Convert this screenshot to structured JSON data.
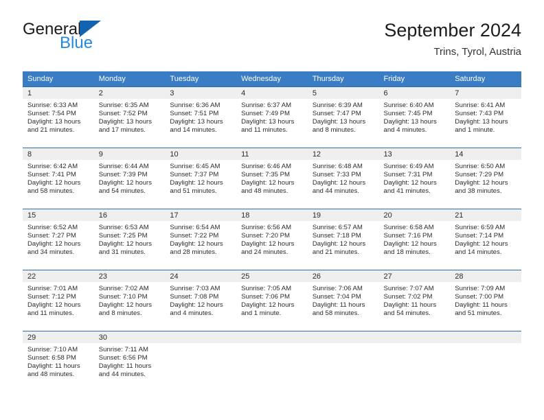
{
  "brand": {
    "name_part1": "General",
    "name_part2": "Blue",
    "logo_icon": "triangle-flag-icon",
    "accent_color": "#2389e0",
    "triangle_color": "#1263b0"
  },
  "header": {
    "title": "September 2024",
    "subtitle": "Trins, Tyrol, Austria"
  },
  "theme": {
    "header_row_bg": "#3b7dc4",
    "cell_border": "#2f6daf",
    "daynum_bg": "#efeff0",
    "text_color": "#2b2b2b"
  },
  "weekday_headers": [
    "Sunday",
    "Monday",
    "Tuesday",
    "Wednesday",
    "Thursday",
    "Friday",
    "Saturday"
  ],
  "weeks": [
    [
      {
        "day": "1",
        "sunrise": "Sunrise: 6:33 AM",
        "sunset": "Sunset: 7:54 PM",
        "daylight_line1": "Daylight: 13 hours",
        "daylight_line2": "and 21 minutes."
      },
      {
        "day": "2",
        "sunrise": "Sunrise: 6:35 AM",
        "sunset": "Sunset: 7:52 PM",
        "daylight_line1": "Daylight: 13 hours",
        "daylight_line2": "and 17 minutes."
      },
      {
        "day": "3",
        "sunrise": "Sunrise: 6:36 AM",
        "sunset": "Sunset: 7:51 PM",
        "daylight_line1": "Daylight: 13 hours",
        "daylight_line2": "and 14 minutes."
      },
      {
        "day": "4",
        "sunrise": "Sunrise: 6:37 AM",
        "sunset": "Sunset: 7:49 PM",
        "daylight_line1": "Daylight: 13 hours",
        "daylight_line2": "and 11 minutes."
      },
      {
        "day": "5",
        "sunrise": "Sunrise: 6:39 AM",
        "sunset": "Sunset: 7:47 PM",
        "daylight_line1": "Daylight: 13 hours",
        "daylight_line2": "and 8 minutes."
      },
      {
        "day": "6",
        "sunrise": "Sunrise: 6:40 AM",
        "sunset": "Sunset: 7:45 PM",
        "daylight_line1": "Daylight: 13 hours",
        "daylight_line2": "and 4 minutes."
      },
      {
        "day": "7",
        "sunrise": "Sunrise: 6:41 AM",
        "sunset": "Sunset: 7:43 PM",
        "daylight_line1": "Daylight: 13 hours",
        "daylight_line2": "and 1 minute."
      }
    ],
    [
      {
        "day": "8",
        "sunrise": "Sunrise: 6:42 AM",
        "sunset": "Sunset: 7:41 PM",
        "daylight_line1": "Daylight: 12 hours",
        "daylight_line2": "and 58 minutes."
      },
      {
        "day": "9",
        "sunrise": "Sunrise: 6:44 AM",
        "sunset": "Sunset: 7:39 PM",
        "daylight_line1": "Daylight: 12 hours",
        "daylight_line2": "and 54 minutes."
      },
      {
        "day": "10",
        "sunrise": "Sunrise: 6:45 AM",
        "sunset": "Sunset: 7:37 PM",
        "daylight_line1": "Daylight: 12 hours",
        "daylight_line2": "and 51 minutes."
      },
      {
        "day": "11",
        "sunrise": "Sunrise: 6:46 AM",
        "sunset": "Sunset: 7:35 PM",
        "daylight_line1": "Daylight: 12 hours",
        "daylight_line2": "and 48 minutes."
      },
      {
        "day": "12",
        "sunrise": "Sunrise: 6:48 AM",
        "sunset": "Sunset: 7:33 PM",
        "daylight_line1": "Daylight: 12 hours",
        "daylight_line2": "and 44 minutes."
      },
      {
        "day": "13",
        "sunrise": "Sunrise: 6:49 AM",
        "sunset": "Sunset: 7:31 PM",
        "daylight_line1": "Daylight: 12 hours",
        "daylight_line2": "and 41 minutes."
      },
      {
        "day": "14",
        "sunrise": "Sunrise: 6:50 AM",
        "sunset": "Sunset: 7:29 PM",
        "daylight_line1": "Daylight: 12 hours",
        "daylight_line2": "and 38 minutes."
      }
    ],
    [
      {
        "day": "15",
        "sunrise": "Sunrise: 6:52 AM",
        "sunset": "Sunset: 7:27 PM",
        "daylight_line1": "Daylight: 12 hours",
        "daylight_line2": "and 34 minutes."
      },
      {
        "day": "16",
        "sunrise": "Sunrise: 6:53 AM",
        "sunset": "Sunset: 7:25 PM",
        "daylight_line1": "Daylight: 12 hours",
        "daylight_line2": "and 31 minutes."
      },
      {
        "day": "17",
        "sunrise": "Sunrise: 6:54 AM",
        "sunset": "Sunset: 7:22 PM",
        "daylight_line1": "Daylight: 12 hours",
        "daylight_line2": "and 28 minutes."
      },
      {
        "day": "18",
        "sunrise": "Sunrise: 6:56 AM",
        "sunset": "Sunset: 7:20 PM",
        "daylight_line1": "Daylight: 12 hours",
        "daylight_line2": "and 24 minutes."
      },
      {
        "day": "19",
        "sunrise": "Sunrise: 6:57 AM",
        "sunset": "Sunset: 7:18 PM",
        "daylight_line1": "Daylight: 12 hours",
        "daylight_line2": "and 21 minutes."
      },
      {
        "day": "20",
        "sunrise": "Sunrise: 6:58 AM",
        "sunset": "Sunset: 7:16 PM",
        "daylight_line1": "Daylight: 12 hours",
        "daylight_line2": "and 18 minutes."
      },
      {
        "day": "21",
        "sunrise": "Sunrise: 6:59 AM",
        "sunset": "Sunset: 7:14 PM",
        "daylight_line1": "Daylight: 12 hours",
        "daylight_line2": "and 14 minutes."
      }
    ],
    [
      {
        "day": "22",
        "sunrise": "Sunrise: 7:01 AM",
        "sunset": "Sunset: 7:12 PM",
        "daylight_line1": "Daylight: 12 hours",
        "daylight_line2": "and 11 minutes."
      },
      {
        "day": "23",
        "sunrise": "Sunrise: 7:02 AM",
        "sunset": "Sunset: 7:10 PM",
        "daylight_line1": "Daylight: 12 hours",
        "daylight_line2": "and 8 minutes."
      },
      {
        "day": "24",
        "sunrise": "Sunrise: 7:03 AM",
        "sunset": "Sunset: 7:08 PM",
        "daylight_line1": "Daylight: 12 hours",
        "daylight_line2": "and 4 minutes."
      },
      {
        "day": "25",
        "sunrise": "Sunrise: 7:05 AM",
        "sunset": "Sunset: 7:06 PM",
        "daylight_line1": "Daylight: 12 hours",
        "daylight_line2": "and 1 minute."
      },
      {
        "day": "26",
        "sunrise": "Sunrise: 7:06 AM",
        "sunset": "Sunset: 7:04 PM",
        "daylight_line1": "Daylight: 11 hours",
        "daylight_line2": "and 58 minutes."
      },
      {
        "day": "27",
        "sunrise": "Sunrise: 7:07 AM",
        "sunset": "Sunset: 7:02 PM",
        "daylight_line1": "Daylight: 11 hours",
        "daylight_line2": "and 54 minutes."
      },
      {
        "day": "28",
        "sunrise": "Sunrise: 7:09 AM",
        "sunset": "Sunset: 7:00 PM",
        "daylight_line1": "Daylight: 11 hours",
        "daylight_line2": "and 51 minutes."
      }
    ],
    [
      {
        "day": "29",
        "sunrise": "Sunrise: 7:10 AM",
        "sunset": "Sunset: 6:58 PM",
        "daylight_line1": "Daylight: 11 hours",
        "daylight_line2": "and 48 minutes."
      },
      {
        "day": "30",
        "sunrise": "Sunrise: 7:11 AM",
        "sunset": "Sunset: 6:56 PM",
        "daylight_line1": "Daylight: 11 hours",
        "daylight_line2": "and 44 minutes."
      },
      {
        "day": "",
        "sunrise": "",
        "sunset": "",
        "daylight_line1": "",
        "daylight_line2": ""
      },
      {
        "day": "",
        "sunrise": "",
        "sunset": "",
        "daylight_line1": "",
        "daylight_line2": ""
      },
      {
        "day": "",
        "sunrise": "",
        "sunset": "",
        "daylight_line1": "",
        "daylight_line2": ""
      },
      {
        "day": "",
        "sunrise": "",
        "sunset": "",
        "daylight_line1": "",
        "daylight_line2": ""
      },
      {
        "day": "",
        "sunrise": "",
        "sunset": "",
        "daylight_line1": "",
        "daylight_line2": ""
      }
    ]
  ]
}
